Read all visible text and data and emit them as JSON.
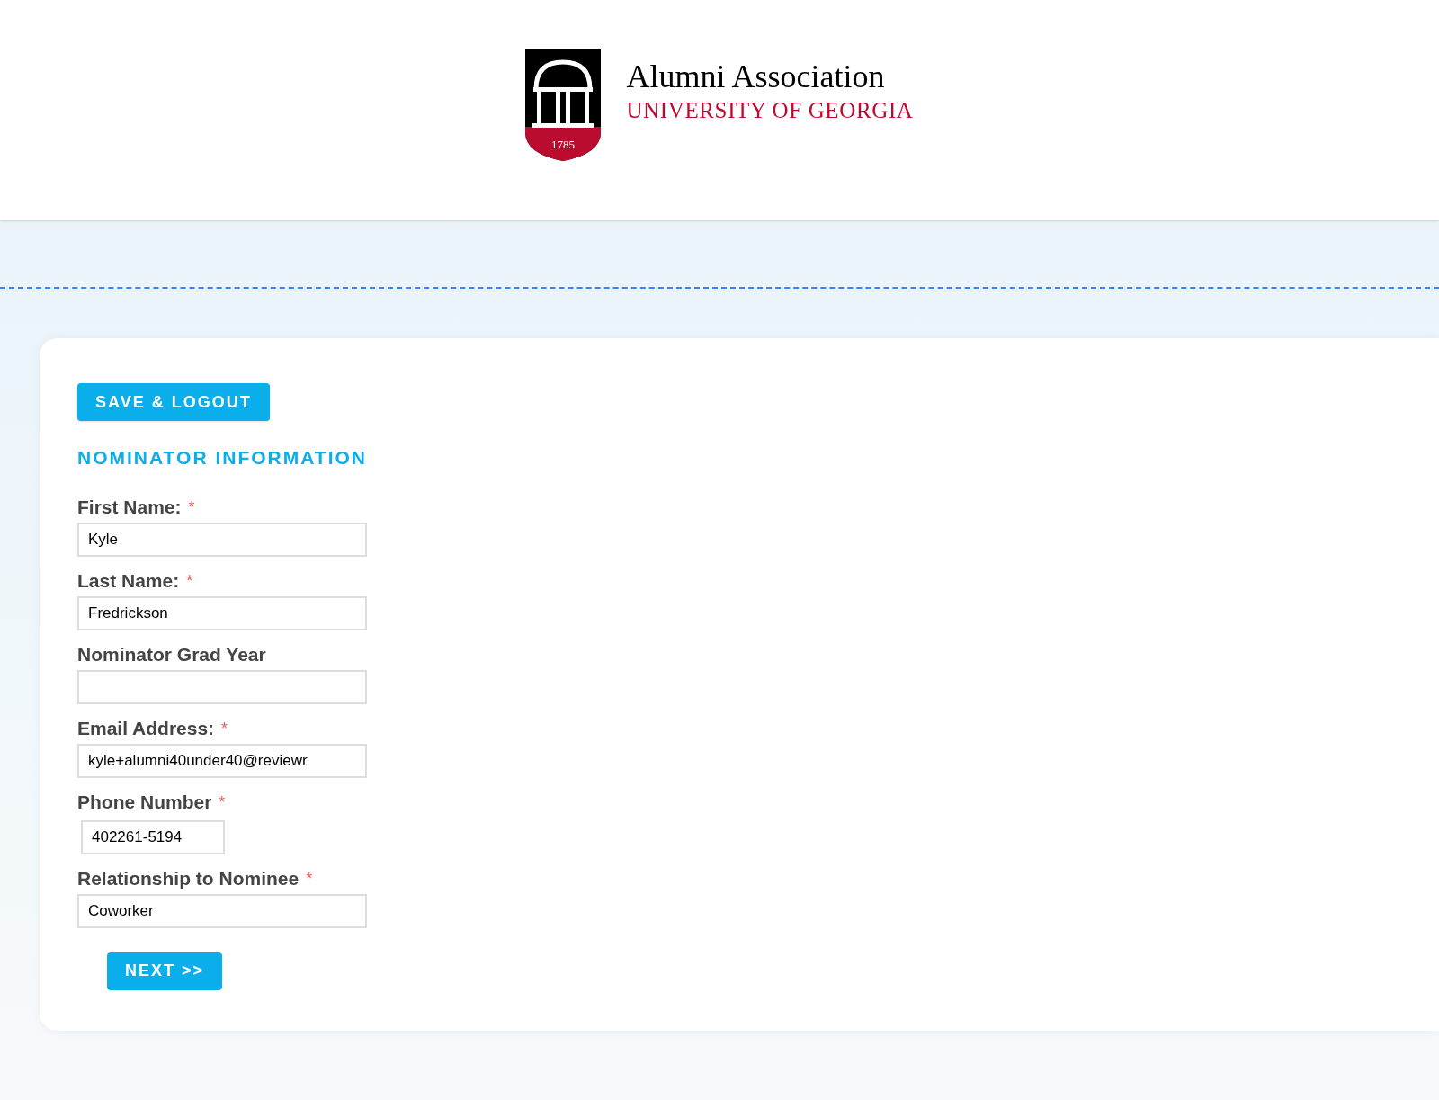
{
  "header": {
    "logo": {
      "year": "1785",
      "title": "Alumni Association",
      "subtitle": "UNIVERSITY OF GEORGIA"
    }
  },
  "form": {
    "save_button": "SAVE & LOGOUT",
    "section_title": "NOMINATOR INFORMATION",
    "fields": [
      {
        "label": "First Name:",
        "required": true,
        "kind": "text",
        "value": "Kyle"
      },
      {
        "label": "Last Name:",
        "required": true,
        "kind": "text",
        "value": "Fredrickson"
      },
      {
        "label": "Nominator Grad Year",
        "required": false,
        "kind": "text"
      },
      {
        "label": "Email Address:",
        "required": true,
        "kind": "text",
        "value": "kyle+alumni40under40@reviewr"
      },
      {
        "label": "Phone Number",
        "required": true,
        "kind": "phone",
        "value": "402261-5194"
      },
      {
        "label": "Relationship to Nominee",
        "required": true,
        "kind": "text",
        "value": "Coworker"
      }
    ],
    "next_button": "NEXT >>",
    "required_mark": "*"
  }
}
